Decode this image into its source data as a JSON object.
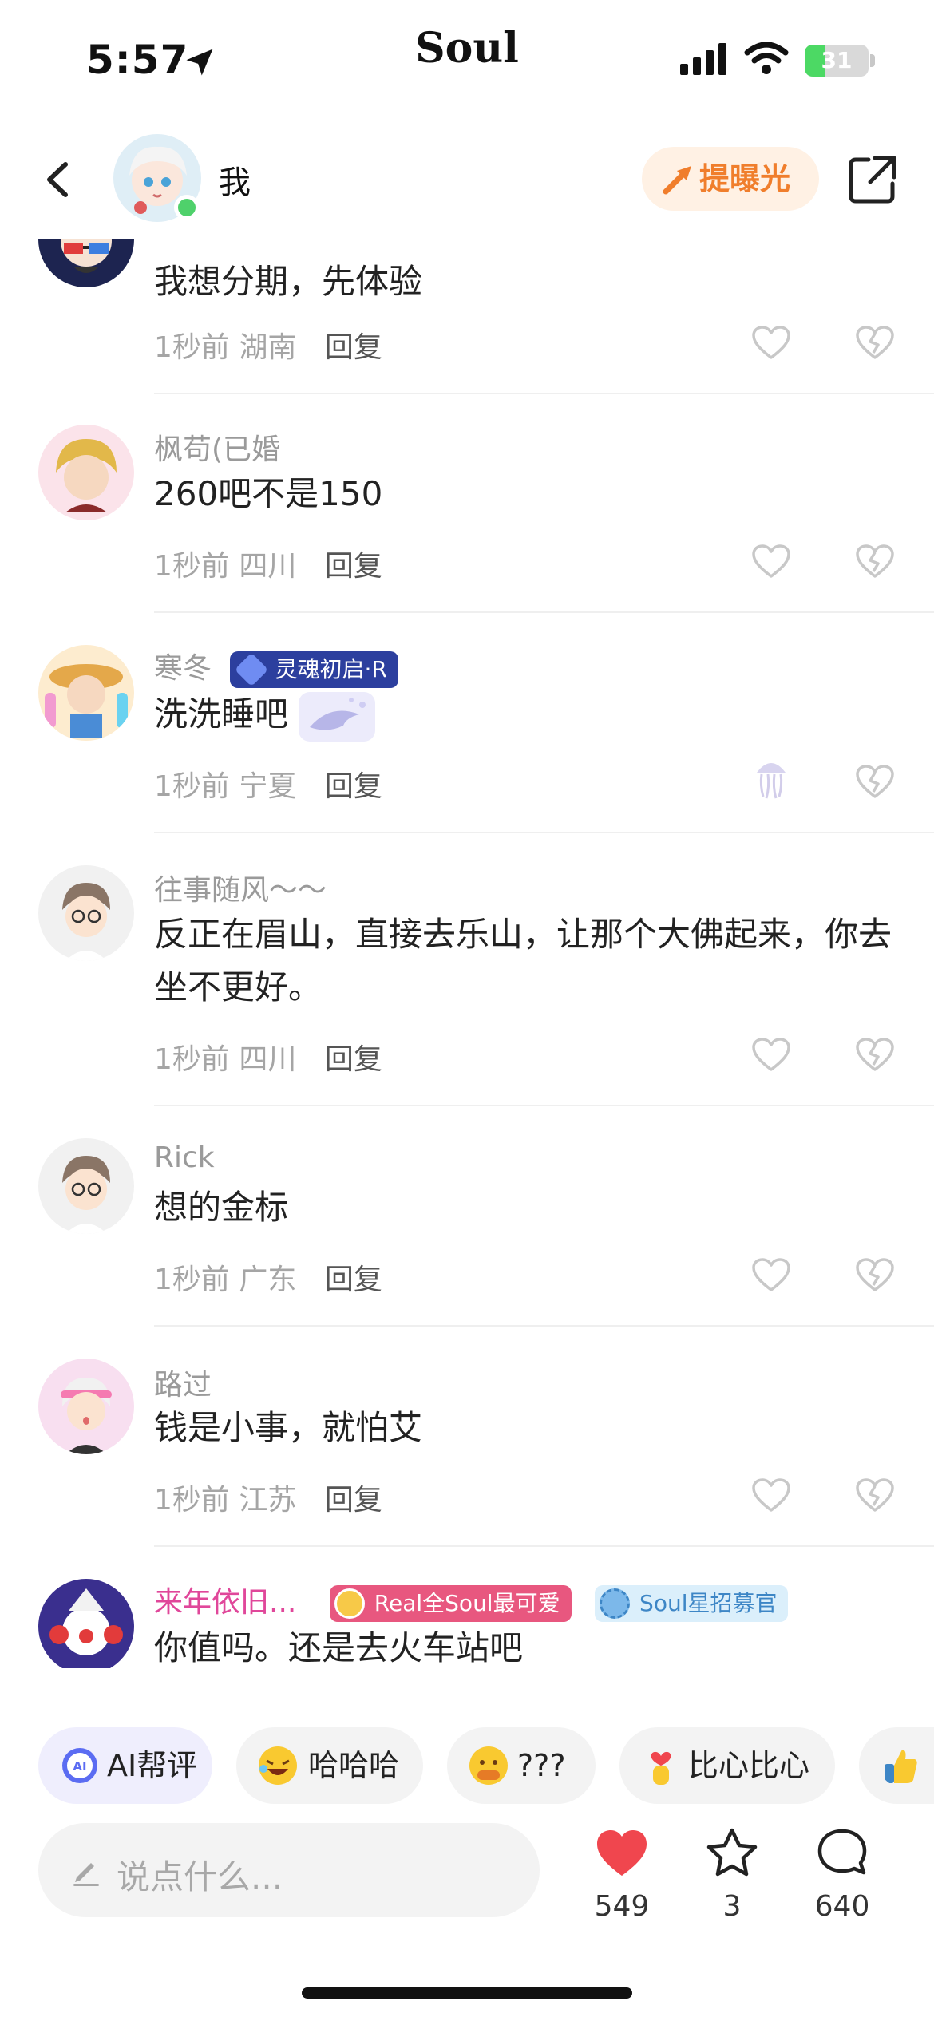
{
  "status_bar": {
    "time": "5:57",
    "app_brand": "Soul",
    "battery_text": "31",
    "battery_level_percent": 31
  },
  "header": {
    "name": "我",
    "expose_label": "提曝光"
  },
  "comments": [
    {
      "name": "",
      "text": "我想分期，先体验",
      "time": "1秒前",
      "region": "湖南",
      "reply": "回复"
    },
    {
      "name": "枫苟(已婚",
      "text": "260吧不是150",
      "time": "1秒前",
      "region": "四川",
      "reply": "回复"
    },
    {
      "name": "寒冬",
      "badge": "灵魂初启·R",
      "text": "洗洗睡吧",
      "time": "1秒前",
      "region": "宁夏",
      "reply": "回复"
    },
    {
      "name": "往事随风～～",
      "text": "反正在眉山，直接去乐山，让那个大佛起来，你去坐不更好。",
      "time": "1秒前",
      "region": "四川",
      "reply": "回复"
    },
    {
      "name": "Rick",
      "text": "想的金标",
      "time": "1秒前",
      "region": "广东",
      "reply": "回复"
    },
    {
      "name": "路过",
      "text": "钱是小事，就怕艾",
      "time": "1秒前",
      "region": "江苏",
      "reply": "回复"
    },
    {
      "name": "来年依旧...",
      "badge1": "Real全Soul最可爱",
      "badge2": "Soul星招募官",
      "text": "你值吗。还是去火车站吧"
    }
  ],
  "quick_reactions": [
    {
      "label": "AI帮评",
      "icon": "ai-icon"
    },
    {
      "label": "哈哈哈",
      "icon": "laughing-emoji-icon"
    },
    {
      "label": "???",
      "icon": "thinking-emoji-icon"
    },
    {
      "label": "比心比心",
      "icon": "finger-heart-emoji-icon"
    },
    {
      "label": "",
      "icon": "thumbs-up-emoji-icon"
    }
  ],
  "bottom_bar": {
    "input_placeholder": "说点什么...",
    "likes_count": "549",
    "stars_count": "3",
    "comments_count": "640"
  },
  "colors": {
    "expose_orange": "#f07e2c",
    "like_red": "#f0464e",
    "vip_name_pink": "#e0479a",
    "online_green": "#4fd16b"
  }
}
